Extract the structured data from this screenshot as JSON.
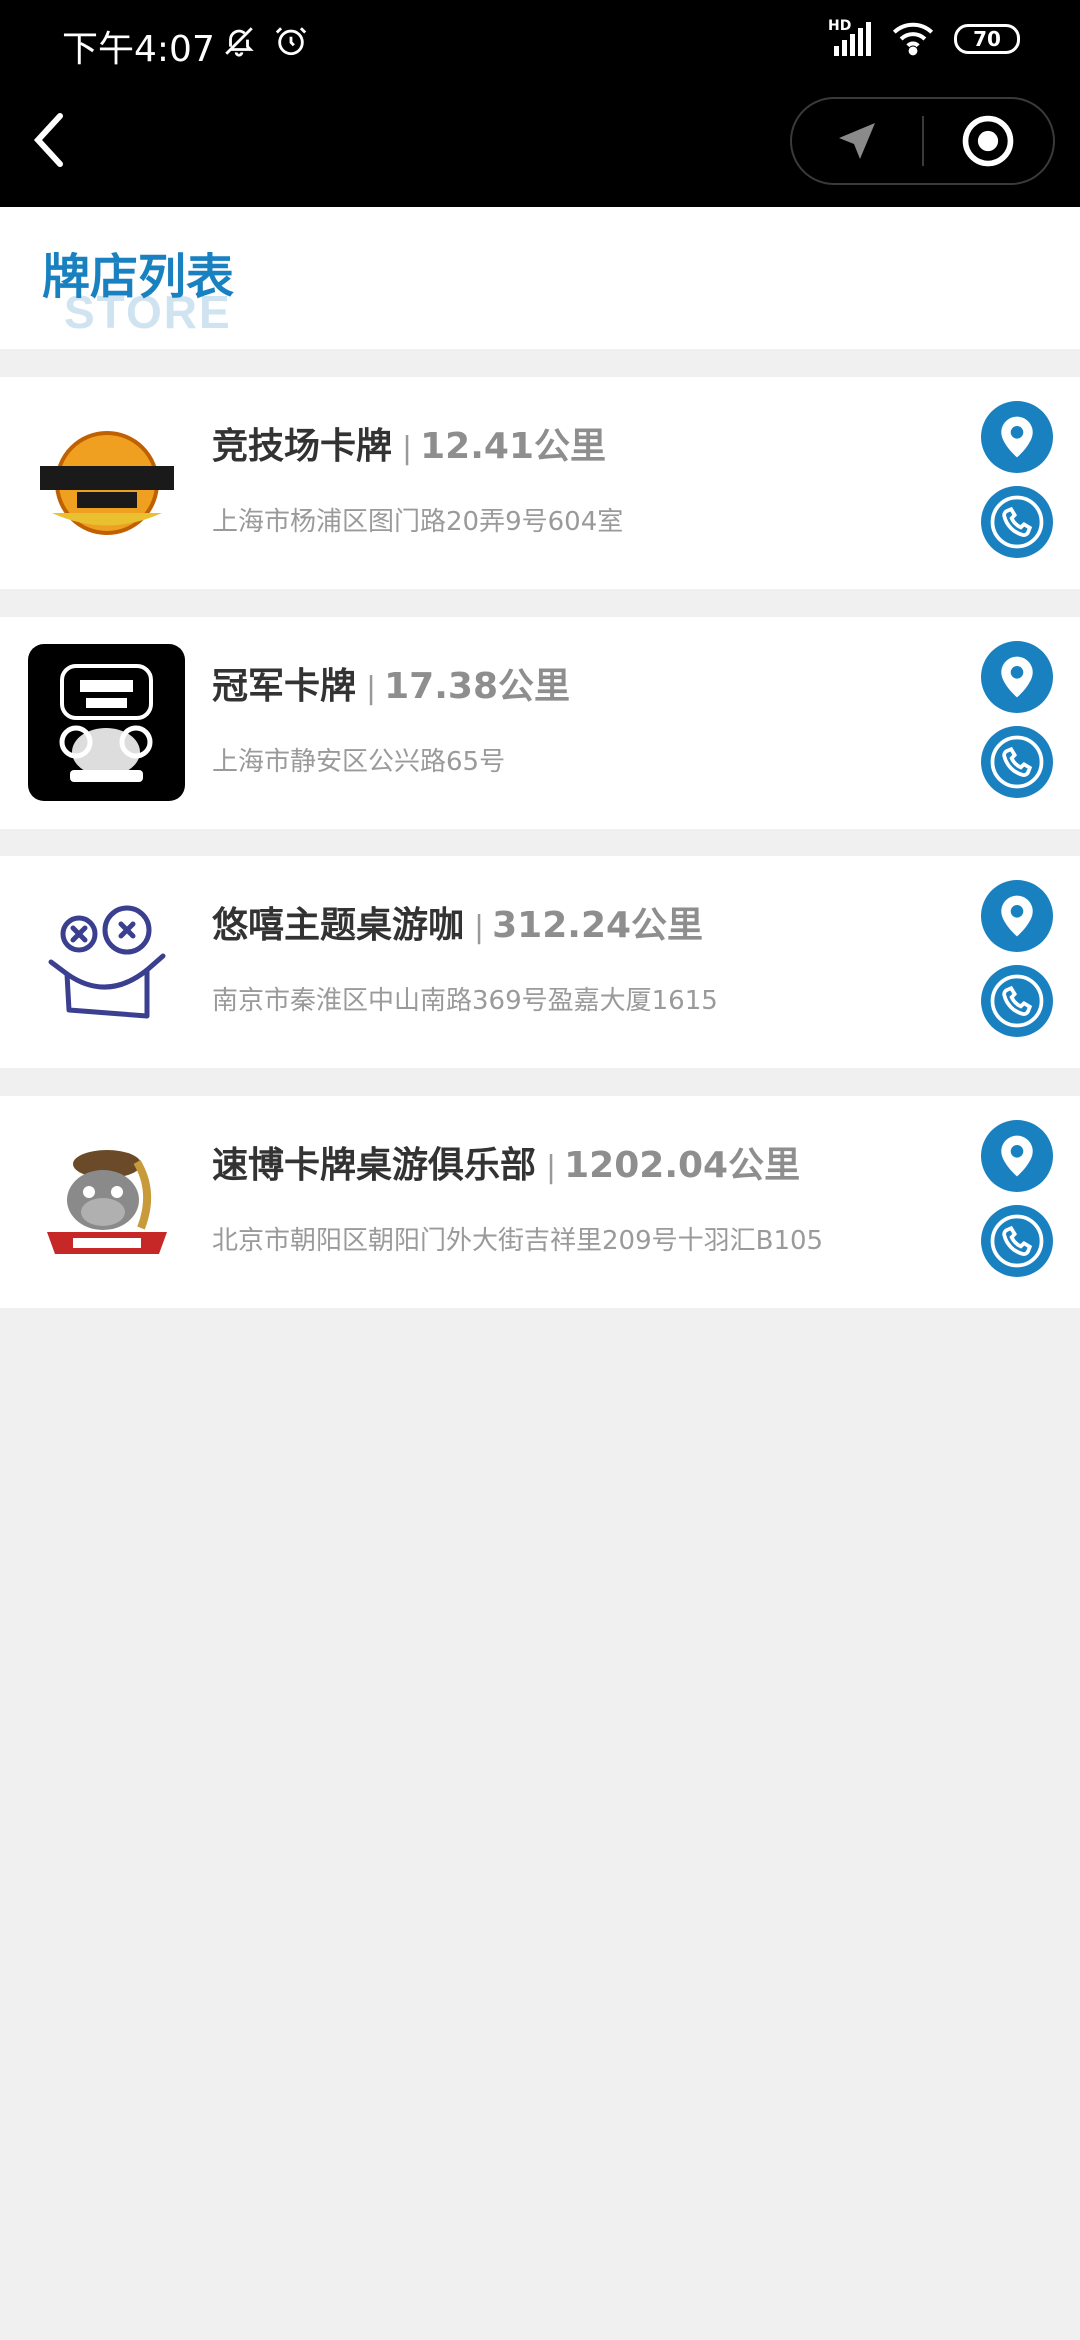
{
  "status_bar": {
    "time": "下午4:07",
    "battery": "70",
    "network": "HD"
  },
  "nav": {
    "back_icon": "chevron-left-icon",
    "pill_icons": [
      "navigation-arrow-icon",
      "target-icon"
    ]
  },
  "header": {
    "title": "牌店列表",
    "subtitle": "STORE"
  },
  "colors": {
    "accent": "#1a81c1",
    "background": "#f0f0f0",
    "topbar": "#000000"
  },
  "stores": [
    {
      "name": "竞技场卡牌",
      "distance": "12.41公里",
      "address": "上海市杨浦区图门路20弄9号604室",
      "logo": "arena-card-logo"
    },
    {
      "name": "冠军卡牌",
      "distance": "17.38公里",
      "address": "上海市静安区公兴路65号",
      "logo": "champion-card-logo"
    },
    {
      "name": "悠嘻主题桌游咖",
      "distance": "312.24公里",
      "address": "南京市秦淮区中山南路369号盈嘉大厦1615",
      "logo": "youxi-mascot-logo"
    },
    {
      "name": "速博卡牌桌游俱乐部",
      "distance": "1202.04公里",
      "address": "北京市朝阳区朝阳门外大街吉祥里209号十羽汇B105",
      "logo": "superpro-logo"
    }
  ]
}
